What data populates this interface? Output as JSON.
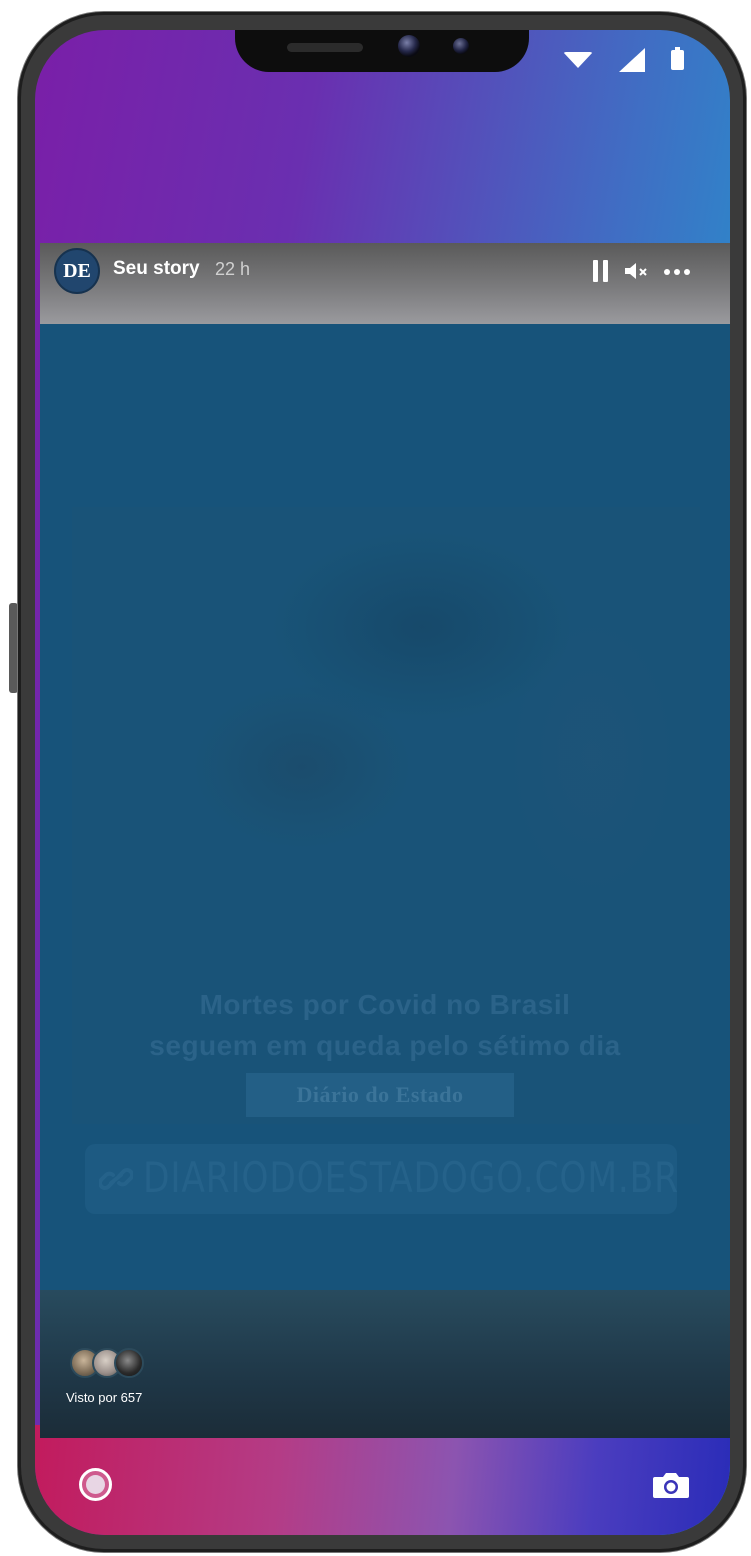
{
  "story": {
    "account_initials": "DE",
    "title": "Seu story",
    "age": "22 h"
  },
  "post": {
    "headline_line1": "Mortes por Covid no Brasil",
    "headline_line2": "seguem em queda pelo sétimo dia",
    "brand": "Diário do Estado",
    "link": "DIARIODOESTADOGO.COM.BR"
  },
  "viewers": {
    "label": "Visto por 657"
  },
  "colors": {
    "story_background": "#17537a",
    "header_gray": "#7b7b7d",
    "accent_purple": "#7a1fa8",
    "accent_cyan": "#15a8d2"
  },
  "icons": [
    "wifi-icon",
    "signal-icon",
    "battery-icon",
    "pause-icon",
    "mute-icon",
    "more-icon",
    "link-icon",
    "home-circle-button",
    "camera-icon"
  ]
}
